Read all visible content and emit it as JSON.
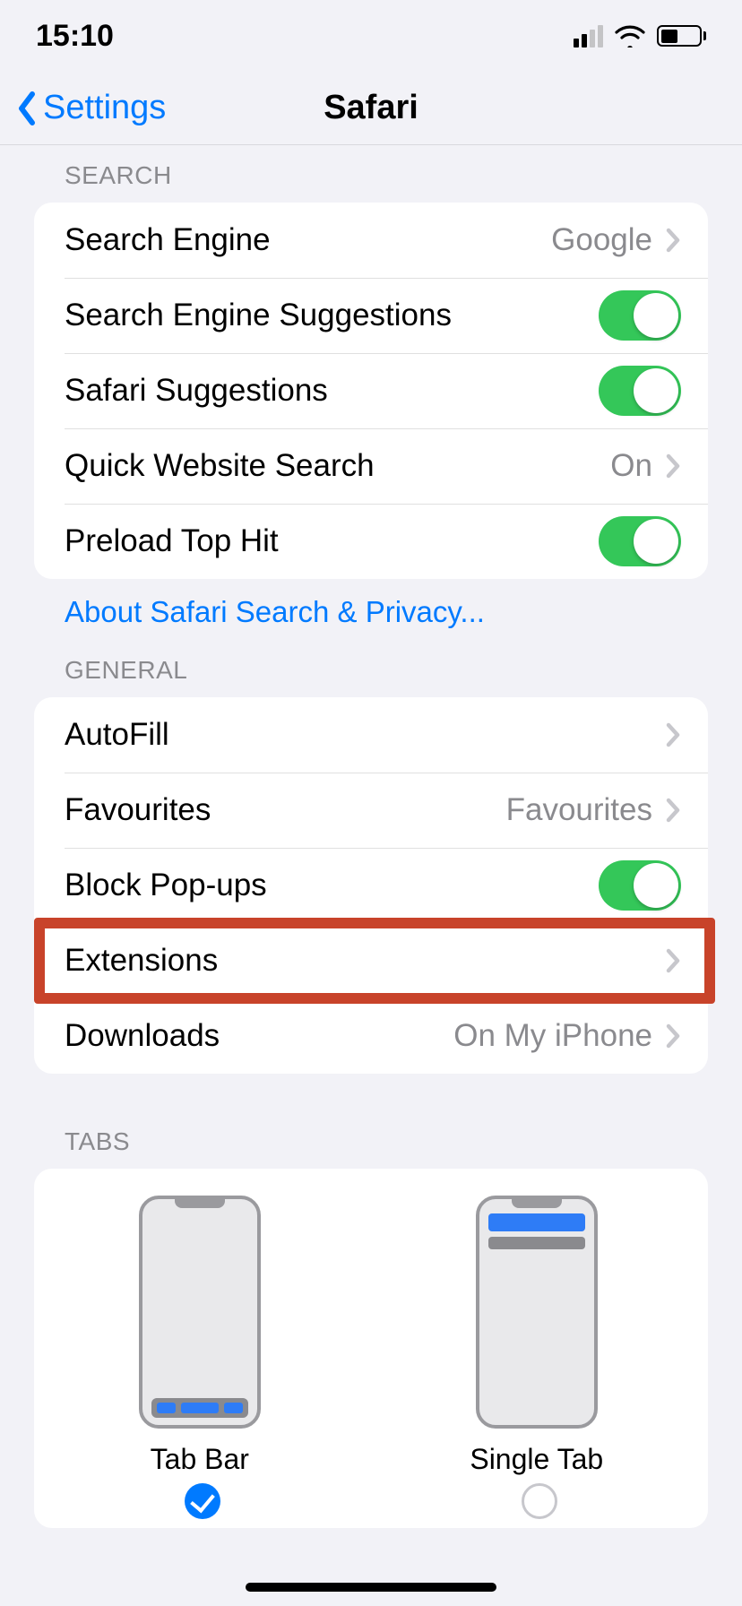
{
  "status": {
    "time": "15:10",
    "battery_pct": 45,
    "signal_active_bars": 2,
    "signal_total_bars": 4
  },
  "nav": {
    "back_label": "Settings",
    "title": "Safari"
  },
  "sections": {
    "search": {
      "header": "SEARCH",
      "search_engine": {
        "label": "Search Engine",
        "value": "Google"
      },
      "search_suggestions": {
        "label": "Search Engine Suggestions",
        "on": true
      },
      "safari_suggestions": {
        "label": "Safari Suggestions",
        "on": true
      },
      "quick_website_search": {
        "label": "Quick Website Search",
        "value": "On"
      },
      "preload_top_hit": {
        "label": "Preload Top Hit",
        "on": true
      },
      "footer_link": "About Safari Search & Privacy..."
    },
    "general": {
      "header": "GENERAL",
      "autofill": {
        "label": "AutoFill"
      },
      "favourites": {
        "label": "Favourites",
        "value": "Favourites"
      },
      "block_popups": {
        "label": "Block Pop-ups",
        "on": true
      },
      "extensions": {
        "label": "Extensions"
      },
      "downloads": {
        "label": "Downloads",
        "value": "On My iPhone"
      }
    },
    "tabs": {
      "header": "TABS",
      "options": {
        "tab_bar": "Tab Bar",
        "single_tab": "Single Tab"
      },
      "selected": "tab_bar"
    }
  },
  "highlight": {
    "target": "extensions-row"
  }
}
